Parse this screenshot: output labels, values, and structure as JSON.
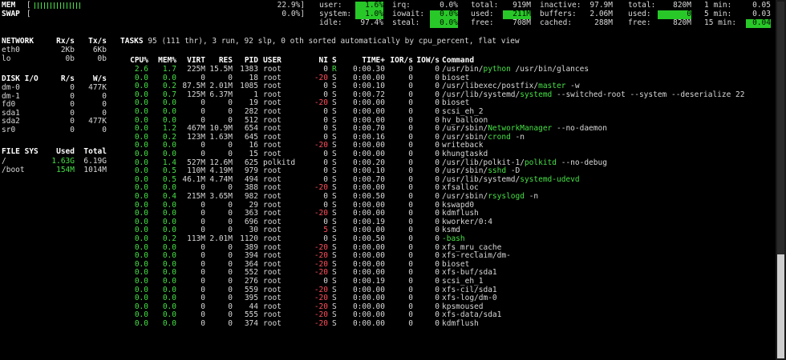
{
  "mem": {
    "label": "MEM",
    "open": "[",
    "percent": "22.9%]"
  },
  "swap": {
    "label": "SWAP",
    "open": "[",
    "percent": "0.0%]"
  },
  "cpu": {
    "user_label": "user:",
    "user": "1.6%",
    "system_label": "system:",
    "system": "1.0%",
    "idle_label": "idle:",
    "idle": "97.4%",
    "irq_label": "irq:",
    "irq": "0.0%",
    "iowait_label": "iowait:",
    "iowait": "0.0%",
    "steal_label": "steal:",
    "steal": "0.0%"
  },
  "memstats": {
    "total_label": "total:",
    "total": "919M",
    "used_label": "used:",
    "used": "211M",
    "free_label": "free:",
    "free": "708M",
    "inactive_label": "inactive:",
    "inactive": "97.9M",
    "buffers_label": "buffers:",
    "buffers": "2.06M",
    "cached_label": "cached:",
    "cached": "288M"
  },
  "swapstats": {
    "total_label": "total:",
    "total": "820M",
    "used_label": "used:",
    "used": "0",
    "free_label": "free:",
    "free": "820M"
  },
  "load": {
    "min1_label": "1 min:",
    "min1": "0.05",
    "min5_label": "5 min:",
    "min5": "0.03",
    "min15_label": "15 min:",
    "min15": "0.04"
  },
  "network": {
    "title": "NETWORK",
    "rx_header": "Rx/s",
    "tx_header": "Tx/s",
    "rows": [
      {
        "name": "eth0",
        "rx": "2Kb",
        "tx": "6Kb"
      },
      {
        "name": "lo",
        "rx": "0b",
        "tx": "0b"
      }
    ]
  },
  "disk": {
    "title": "DISK I/O",
    "r_header": "R/s",
    "w_header": "W/s",
    "rows": [
      {
        "name": "dm-0",
        "r": "0",
        "w": "477K"
      },
      {
        "name": "dm-1",
        "r": "0",
        "w": "0"
      },
      {
        "name": "fd0",
        "r": "0",
        "w": "0"
      },
      {
        "name": "sda1",
        "r": "0",
        "w": "0"
      },
      {
        "name": "sda2",
        "r": "0",
        "w": "477K"
      },
      {
        "name": "sr0",
        "r": "0",
        "w": "0"
      }
    ]
  },
  "fs": {
    "title": "FILE SYS",
    "used_header": "Used",
    "total_header": "Total",
    "rows": [
      {
        "name": "/",
        "used": "1.63G",
        "total": "6.19G"
      },
      {
        "name": "/boot",
        "used": "154M",
        "total": "1014M"
      }
    ]
  },
  "tasks": {
    "label": "TASKS",
    "summary": " 95 (111 thr), 3 run, 92 slp, 0 oth sorted automatically by cpu_percent, flat view"
  },
  "proc_header": {
    "cpu": "CPU%",
    "mem": "MEM%",
    "virt": "VIRT",
    "res": "RES",
    "pid": "PID",
    "user": "USER",
    "ni": "NI",
    "s": "S",
    "time": "TIME+",
    "ior": "IOR/s",
    "iow": "IOW/s",
    "cmd": "Command"
  },
  "processes": [
    {
      "cpu": "2.6",
      "mem": "1.7",
      "virt": "225M",
      "res": "15.5M",
      "pid": "1383",
      "user": "root",
      "ni": "0",
      "s": "R",
      "time": "0:00.30",
      "ior": "0",
      "iow": "0",
      "cmd_pre": "/usr/bin/",
      "cmd_hl": "python",
      "cmd_post": " /usr/bin/glances"
    },
    {
      "cpu": "0.0",
      "mem": "0.0",
      "virt": "0",
      "res": "0",
      "pid": "18",
      "user": "root",
      "ni": "-20",
      "s": "S",
      "time": "0:00.00",
      "ior": "0",
      "iow": "0",
      "cmd_pre": "bioset",
      "cmd_hl": "",
      "cmd_post": ""
    },
    {
      "cpu": "0.0",
      "mem": "0.2",
      "virt": "87.5M",
      "res": "2.01M",
      "pid": "1085",
      "user": "root",
      "ni": "0",
      "s": "S",
      "time": "0:00.10",
      "ior": "0",
      "iow": "0",
      "cmd_pre": "/usr/libexec/postfix/",
      "cmd_hl": "master",
      "cmd_post": " -w"
    },
    {
      "cpu": "0.0",
      "mem": "0.7",
      "virt": "125M",
      "res": "6.37M",
      "pid": "1",
      "user": "root",
      "ni": "0",
      "s": "S",
      "time": "0:00.72",
      "ior": "0",
      "iow": "0",
      "cmd_pre": "/usr/lib/systemd/",
      "cmd_hl": "systemd",
      "cmd_post": " --switched-root --system --deserialize 22"
    },
    {
      "cpu": "0.0",
      "mem": "0.0",
      "virt": "0",
      "res": "0",
      "pid": "19",
      "user": "root",
      "ni": "-20",
      "s": "S",
      "time": "0:00.00",
      "ior": "0",
      "iow": "0",
      "cmd_pre": "bioset",
      "cmd_hl": "",
      "cmd_post": ""
    },
    {
      "cpu": "0.0",
      "mem": "0.0",
      "virt": "0",
      "res": "0",
      "pid": "282",
      "user": "root",
      "ni": "0",
      "s": "S",
      "time": "0:00.00",
      "ior": "0",
      "iow": "0",
      "cmd_pre": "scsi_eh_2",
      "cmd_hl": "",
      "cmd_post": ""
    },
    {
      "cpu": "0.0",
      "mem": "0.0",
      "virt": "0",
      "res": "0",
      "pid": "512",
      "user": "root",
      "ni": "0",
      "s": "S",
      "time": "0:00.00",
      "ior": "0",
      "iow": "0",
      "cmd_pre": "hv_balloon",
      "cmd_hl": "",
      "cmd_post": ""
    },
    {
      "cpu": "0.0",
      "mem": "1.2",
      "virt": "467M",
      "res": "10.9M",
      "pid": "654",
      "user": "root",
      "ni": "0",
      "s": "S",
      "time": "0:00.70",
      "ior": "0",
      "iow": "0",
      "cmd_pre": "/usr/sbin/",
      "cmd_hl": "NetworkManager",
      "cmd_post": " --no-daemon"
    },
    {
      "cpu": "0.0",
      "mem": "0.2",
      "virt": "123M",
      "res": "1.63M",
      "pid": "645",
      "user": "root",
      "ni": "0",
      "s": "S",
      "time": "0:00.16",
      "ior": "0",
      "iow": "0",
      "cmd_pre": "/usr/sbin/",
      "cmd_hl": "crond",
      "cmd_post": " -n"
    },
    {
      "cpu": "0.0",
      "mem": "0.0",
      "virt": "0",
      "res": "0",
      "pid": "16",
      "user": "root",
      "ni": "-20",
      "s": "S",
      "time": "0:00.00",
      "ior": "0",
      "iow": "0",
      "cmd_pre": "writeback",
      "cmd_hl": "",
      "cmd_post": ""
    },
    {
      "cpu": "0.0",
      "mem": "0.0",
      "virt": "0",
      "res": "0",
      "pid": "15",
      "user": "root",
      "ni": "0",
      "s": "S",
      "time": "0:00.00",
      "ior": "0",
      "iow": "0",
      "cmd_pre": "khungtaskd",
      "cmd_hl": "",
      "cmd_post": ""
    },
    {
      "cpu": "0.0",
      "mem": "1.4",
      "virt": "527M",
      "res": "12.6M",
      "pid": "625",
      "user": "polkitd",
      "ni": "0",
      "s": "S",
      "time": "0:00.20",
      "ior": "0",
      "iow": "0",
      "cmd_pre": "/usr/lib/polkit-1/",
      "cmd_hl": "polkitd",
      "cmd_post": " --no-debug"
    },
    {
      "cpu": "0.0",
      "mem": "0.5",
      "virt": "110M",
      "res": "4.19M",
      "pid": "979",
      "user": "root",
      "ni": "0",
      "s": "S",
      "time": "0:00.10",
      "ior": "0",
      "iow": "0",
      "cmd_pre": "/usr/sbin/",
      "cmd_hl": "sshd",
      "cmd_post": " -D"
    },
    {
      "cpu": "0.0",
      "mem": "0.5",
      "virt": "46.1M",
      "res": "4.74M",
      "pid": "494",
      "user": "root",
      "ni": "0",
      "s": "S",
      "time": "0:00.70",
      "ior": "0",
      "iow": "0",
      "cmd_pre": "/usr/lib/systemd/",
      "cmd_hl": "systemd-udevd",
      "cmd_post": ""
    },
    {
      "cpu": "0.0",
      "mem": "0.0",
      "virt": "0",
      "res": "0",
      "pid": "388",
      "user": "root",
      "ni": "-20",
      "s": "S",
      "time": "0:00.00",
      "ior": "0",
      "iow": "0",
      "cmd_pre": "xfsalloc",
      "cmd_hl": "",
      "cmd_post": ""
    },
    {
      "cpu": "0.0",
      "mem": "0.4",
      "virt": "215M",
      "res": "3.65M",
      "pid": "982",
      "user": "root",
      "ni": "0",
      "s": "S",
      "time": "0:00.50",
      "ior": "0",
      "iow": "0",
      "cmd_pre": "/usr/sbin/",
      "cmd_hl": "rsyslogd",
      "cmd_post": " -n"
    },
    {
      "cpu": "0.0",
      "mem": "0.0",
      "virt": "0",
      "res": "0",
      "pid": "29",
      "user": "root",
      "ni": "0",
      "s": "S",
      "time": "0:00.00",
      "ior": "0",
      "iow": "0",
      "cmd_pre": "kswapd0",
      "cmd_hl": "",
      "cmd_post": ""
    },
    {
      "cpu": "0.0",
      "mem": "0.0",
      "virt": "0",
      "res": "0",
      "pid": "363",
      "user": "root",
      "ni": "-20",
      "s": "S",
      "time": "0:00.00",
      "ior": "0",
      "iow": "0",
      "cmd_pre": "kdmflush",
      "cmd_hl": "",
      "cmd_post": ""
    },
    {
      "cpu": "0.0",
      "mem": "0.0",
      "virt": "0",
      "res": "0",
      "pid": "696",
      "user": "root",
      "ni": "0",
      "s": "S",
      "time": "0:00.19",
      "ior": "0",
      "iow": "0",
      "cmd_pre": "kworker/0:4",
      "cmd_hl": "",
      "cmd_post": ""
    },
    {
      "cpu": "0.0",
      "mem": "0.0",
      "virt": "0",
      "res": "0",
      "pid": "30",
      "user": "root",
      "ni": "5",
      "s": "S",
      "time": "0:00.00",
      "ior": "0",
      "iow": "0",
      "cmd_pre": "ksmd",
      "cmd_hl": "",
      "cmd_post": ""
    },
    {
      "cpu": "0.0",
      "mem": "0.2",
      "virt": "113M",
      "res": "2.01M",
      "pid": "1120",
      "user": "root",
      "ni": "0",
      "s": "S",
      "time": "0:00.50",
      "ior": "0",
      "iow": "0",
      "cmd_pre": "",
      "cmd_hl": "-bash",
      "cmd_post": ""
    },
    {
      "cpu": "0.0",
      "mem": "0.0",
      "virt": "0",
      "res": "0",
      "pid": "389",
      "user": "root",
      "ni": "-20",
      "s": "S",
      "time": "0:00.00",
      "ior": "0",
      "iow": "0",
      "cmd_pre": "xfs_mru_cache",
      "cmd_hl": "",
      "cmd_post": ""
    },
    {
      "cpu": "0.0",
      "mem": "0.0",
      "virt": "0",
      "res": "0",
      "pid": "394",
      "user": "root",
      "ni": "-20",
      "s": "S",
      "time": "0:00.00",
      "ior": "0",
      "iow": "0",
      "cmd_pre": "xfs-reclaim/dm-",
      "cmd_hl": "",
      "cmd_post": ""
    },
    {
      "cpu": "0.0",
      "mem": "0.0",
      "virt": "0",
      "res": "0",
      "pid": "364",
      "user": "root",
      "ni": "-20",
      "s": "S",
      "time": "0:00.00",
      "ior": "0",
      "iow": "0",
      "cmd_pre": "bioset",
      "cmd_hl": "",
      "cmd_post": ""
    },
    {
      "cpu": "0.0",
      "mem": "0.0",
      "virt": "0",
      "res": "0",
      "pid": "552",
      "user": "root",
      "ni": "-20",
      "s": "S",
      "time": "0:00.00",
      "ior": "0",
      "iow": "0",
      "cmd_pre": "xfs-buf/sda1",
      "cmd_hl": "",
      "cmd_post": ""
    },
    {
      "cpu": "0.0",
      "mem": "0.0",
      "virt": "0",
      "res": "0",
      "pid": "276",
      "user": "root",
      "ni": "0",
      "s": "S",
      "time": "0:00.19",
      "ior": "0",
      "iow": "0",
      "cmd_pre": "scsi_eh_1",
      "cmd_hl": "",
      "cmd_post": ""
    },
    {
      "cpu": "0.0",
      "mem": "0.0",
      "virt": "0",
      "res": "0",
      "pid": "559",
      "user": "root",
      "ni": "-20",
      "s": "S",
      "time": "0:00.00",
      "ior": "0",
      "iow": "0",
      "cmd_pre": "xfs-cil/sda1",
      "cmd_hl": "",
      "cmd_post": ""
    },
    {
      "cpu": "0.0",
      "mem": "0.0",
      "virt": "0",
      "res": "0",
      "pid": "395",
      "user": "root",
      "ni": "-20",
      "s": "S",
      "time": "0:00.00",
      "ior": "0",
      "iow": "0",
      "cmd_pre": "xfs-log/dm-0",
      "cmd_hl": "",
      "cmd_post": ""
    },
    {
      "cpu": "0.0",
      "mem": "0.0",
      "virt": "0",
      "res": "0",
      "pid": "44",
      "user": "root",
      "ni": "-20",
      "s": "S",
      "time": "0:00.00",
      "ior": "0",
      "iow": "0",
      "cmd_pre": "kpsmoused",
      "cmd_hl": "",
      "cmd_post": ""
    },
    {
      "cpu": "0.0",
      "mem": "0.0",
      "virt": "0",
      "res": "0",
      "pid": "555",
      "user": "root",
      "ni": "-20",
      "s": "S",
      "time": "0:00.00",
      "ior": "0",
      "iow": "0",
      "cmd_pre": "xfs-data/sda1",
      "cmd_hl": "",
      "cmd_post": ""
    },
    {
      "cpu": "0.0",
      "mem": "0.0",
      "virt": "0",
      "res": "0",
      "pid": "374",
      "user": "root",
      "ni": "-20",
      "s": "S",
      "time": "0:00.00",
      "ior": "0",
      "iow": "0",
      "cmd_pre": "kdmflush",
      "cmd_hl": "",
      "cmd_post": ""
    }
  ]
}
